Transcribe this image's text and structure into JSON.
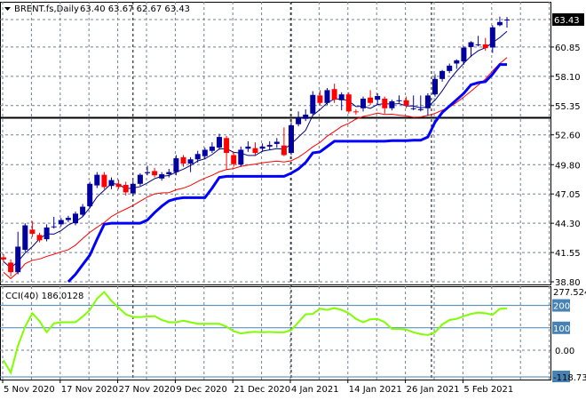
{
  "header": {
    "menu_icon": "triangle-down-icon",
    "symbol": "BRENT.fs,Daily",
    "ohlc": "63.40 63.67 62.67 63.43"
  },
  "colors": {
    "bull": "#0000a0",
    "bear": "#ff0000",
    "fast_line": "#000080",
    "slow_line": "#ff0000",
    "trail_line": "#0000ff",
    "cci_line": "#7fff00",
    "level_line": "#4682b4",
    "grid": "#708090"
  },
  "price_axis": {
    "labels": [
      "60.85",
      "58.10",
      "55.35",
      "52.60",
      "49.80",
      "47.05",
      "44.30",
      "41.55",
      "38.80"
    ],
    "current_price_label": "63.43",
    "range": [
      38.8,
      63.43
    ]
  },
  "horizontal_level": 54.2,
  "cci": {
    "label": "CCI(40) 186.0128",
    "max_label": "277.5241",
    "min_label": "-118.737",
    "levels": [
      "200",
      "100"
    ],
    "zero_label": "0.00",
    "range": [
      -118.737,
      277.5241
    ],
    "values": [
      -45,
      -100,
      20,
      105,
      165,
      130,
      80,
      120,
      125,
      125,
      125,
      150,
      180,
      230,
      260,
      220,
      190,
      160,
      148,
      148,
      150,
      152,
      135,
      125,
      125,
      132,
      125,
      118,
      118,
      118,
      118,
      105,
      85,
      75,
      80,
      82,
      80,
      82,
      80,
      80,
      90,
      125,
      160,
      162,
      185,
      180,
      188,
      180,
      165,
      140,
      125,
      138,
      140,
      125,
      95,
      95,
      92,
      80,
      72,
      68,
      80,
      115,
      135,
      140,
      152,
      162,
      168,
      165,
      158,
      185,
      186
    ]
  },
  "time_axis": {
    "labels": [
      {
        "text": "5 Nov 2020",
        "bar": 0
      },
      {
        "text": "17 Nov 2020",
        "bar": 8
      },
      {
        "text": "27 Nov 2020",
        "bar": 16
      },
      {
        "text": "9 Dec 2020",
        "bar": 24
      },
      {
        "text": "21 Dec 2020",
        "bar": 32
      },
      {
        "text": "4 Jan 2021",
        "bar": 40
      },
      {
        "text": "14 Jan 2021",
        "bar": 48
      },
      {
        "text": "26 Jan 2021",
        "bar": 56
      },
      {
        "text": "5 Feb 2021",
        "bar": 64
      }
    ],
    "separator_bars": [
      18,
      40,
      59.5
    ]
  },
  "chart_data": {
    "type": "candlestick",
    "title": "BRENT.fs,Daily",
    "ohlc_fields": [
      "open",
      "high",
      "low",
      "close"
    ],
    "candles": [
      [
        41.1,
        41.4,
        40.6,
        40.9
      ],
      [
        40.6,
        40.9,
        39.3,
        39.7
      ],
      [
        39.7,
        43.5,
        39.5,
        42.1
      ],
      [
        41.8,
        44.3,
        41.6,
        44.1
      ],
      [
        43.7,
        44.5,
        43.0,
        43.3
      ],
      [
        43.2,
        43.4,
        42.5,
        42.7
      ],
      [
        42.8,
        44.2,
        42.6,
        43.9
      ],
      [
        44.0,
        44.9,
        43.8,
        44.0
      ],
      [
        44.2,
        44.8,
        44.0,
        44.6
      ],
      [
        44.6,
        45.0,
        44.4,
        44.8
      ],
      [
        44.3,
        45.4,
        44.1,
        45.2
      ],
      [
        45.1,
        46.1,
        44.9,
        45.85
      ],
      [
        45.9,
        48.2,
        45.7,
        48.0
      ],
      [
        47.85,
        49.1,
        47.6,
        48.85
      ],
      [
        48.85,
        49.1,
        47.5,
        47.7
      ],
      [
        47.8,
        48.6,
        47.5,
        48.35
      ],
      [
        48.0,
        48.4,
        47.5,
        47.7
      ],
      [
        47.9,
        48.2,
        46.9,
        47.2
      ],
      [
        47.1,
        48.3,
        46.9,
        48.0
      ],
      [
        48.0,
        49.0,
        47.8,
        48.85
      ],
      [
        49.0,
        49.7,
        48.8,
        49.1
      ],
      [
        49.2,
        49.5,
        48.6,
        48.8
      ],
      [
        48.5,
        49.1,
        48.3,
        48.9
      ],
      [
        48.9,
        49.4,
        48.6,
        49.1
      ],
      [
        49.1,
        50.7,
        48.8,
        50.4
      ],
      [
        50.5,
        50.7,
        49.6,
        49.9
      ],
      [
        49.9,
        50.5,
        49.1,
        50.3
      ],
      [
        50.3,
        51.1,
        50.0,
        50.8
      ],
      [
        50.6,
        51.4,
        50.3,
        51.2
      ],
      [
        51.1,
        51.9,
        50.9,
        51.5
      ],
      [
        51.4,
        52.7,
        51.2,
        52.4
      ],
      [
        52.3,
        52.5,
        49.35,
        50.9
      ],
      [
        50.7,
        51.0,
        49.6,
        49.85
      ],
      [
        49.8,
        51.5,
        49.6,
        51.2
      ],
      [
        51.3,
        52.0,
        51.0,
        51.5
      ],
      [
        51.35,
        51.9,
        50.6,
        50.9
      ],
      [
        51.3,
        51.8,
        51.0,
        51.5
      ],
      [
        51.5,
        52.0,
        51.2,
        51.65
      ],
      [
        51.75,
        52.3,
        51.4,
        51.95
      ],
      [
        51.6,
        53.3,
        50.6,
        50.7
      ],
      [
        50.9,
        53.8,
        50.7,
        53.5
      ],
      [
        53.6,
        54.8,
        53.4,
        54.2
      ],
      [
        54.1,
        55.0,
        53.9,
        54.5
      ],
      [
        54.6,
        56.7,
        54.4,
        56.35
      ],
      [
        56.3,
        56.8,
        55.4,
        55.6
      ],
      [
        55.6,
        57.0,
        55.4,
        56.8
      ],
      [
        56.9,
        57.4,
        55.6,
        55.9
      ],
      [
        55.85,
        56.6,
        54.9,
        56.4
      ],
      [
        56.4,
        56.6,
        54.6,
        54.8
      ],
      [
        54.8,
        55.0,
        54.5,
        54.75
      ],
      [
        55.1,
        56.2,
        54.8,
        56.0
      ],
      [
        56.1,
        56.8,
        55.4,
        55.6
      ],
      [
        55.9,
        56.5,
        55.4,
        56.25
      ],
      [
        56.0,
        56.2,
        54.6,
        55.1
      ],
      [
        55.1,
        55.9,
        54.9,
        55.75
      ],
      [
        55.85,
        56.3,
        55.6,
        55.85
      ],
      [
        55.85,
        56.2,
        55.1,
        55.35
      ],
      [
        55.1,
        56.3,
        54.9,
        55.1
      ],
      [
        55.0,
        56.3,
        54.8,
        55.0
      ],
      [
        55.1,
        56.5,
        54.4,
        56.3
      ],
      [
        56.4,
        58.3,
        56.2,
        57.85
      ],
      [
        57.85,
        58.7,
        57.6,
        58.6
      ],
      [
        58.6,
        59.3,
        58.4,
        59.1
      ],
      [
        59.3,
        59.7,
        58.8,
        59.6
      ],
      [
        59.5,
        60.9,
        59.2,
        60.8
      ],
      [
        60.85,
        61.4,
        59.9,
        61.3
      ],
      [
        61.1,
        61.9,
        60.9,
        61.1
      ],
      [
        61.1,
        61.7,
        60.5,
        60.75
      ],
      [
        60.8,
        62.9,
        60.3,
        62.7
      ],
      [
        62.9,
        63.7,
        62.8,
        63.2
      ],
      [
        63.4,
        63.67,
        62.67,
        63.43
      ]
    ],
    "trail_line": [
      null,
      null,
      null,
      null,
      null,
      null,
      null,
      null,
      null,
      38.8,
      39.5,
      40.4,
      41.3,
      42.8,
      44.2,
      44.3,
      44.3,
      44.3,
      44.3,
      44.3,
      44.6,
      45.3,
      45.9,
      46.4,
      46.6,
      46.7,
      46.7,
      46.7,
      46.7,
      47.6,
      48.6,
      48.7,
      48.7,
      48.7,
      48.7,
      48.7,
      48.7,
      48.7,
      48.7,
      48.7,
      49.0,
      49.4,
      50.0,
      50.9,
      51.0,
      51.5,
      52.0,
      52.0,
      52.0,
      52.0,
      52.0,
      52.0,
      52.0,
      52.0,
      52.05,
      52.05,
      52.05,
      52.1,
      52.1,
      52.4,
      53.8,
      54.7,
      55.3,
      55.9,
      56.5,
      57.3,
      57.5,
      57.6,
      58.3,
      59.2,
      59.2
    ]
  }
}
